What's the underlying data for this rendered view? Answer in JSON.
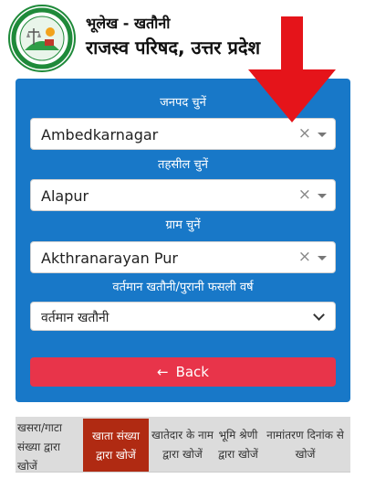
{
  "header": {
    "title_line1": "भूलेख - खतौनी",
    "title_line2": "राजस्व परिषद, उत्तर प्रदेश"
  },
  "form": {
    "district_label": "जनपद चुनें",
    "district_value": "Ambedkarnagar",
    "tehsil_label": "तहसील चुनें",
    "tehsil_value": "Alapur",
    "village_label": "ग्राम चुनें",
    "village_value": "Akthranarayan Pur",
    "year_label": "वर्तमान खतौनी/पुरानी फसली वर्ष",
    "year_value": "वर्तमान खतौनी",
    "clear_glyph": "×",
    "back_label": "Back",
    "back_arrow": "←"
  },
  "tabs": [
    {
      "label": "खसरा/गाटा संख्या द्वारा खोजें"
    },
    {
      "label": "खाता संख्या द्वारा खोजें"
    },
    {
      "label": "खातेदार के नाम द्वारा खोजें"
    },
    {
      "label": "भूमि श्रेणी द्वारा खोजें"
    },
    {
      "label": "नामांतरण दिनांक से खोजें"
    }
  ],
  "colors": {
    "panel": "#1878c8",
    "back_button": "#e8344a",
    "active_tab": "#b02a12",
    "arrow": "#e5141a"
  },
  "icons": [
    "seal-logo-icon",
    "annotation-arrow-icon",
    "clear-icon",
    "dropdown-caret-icon",
    "chevron-down-icon",
    "back-arrow-icon"
  ]
}
